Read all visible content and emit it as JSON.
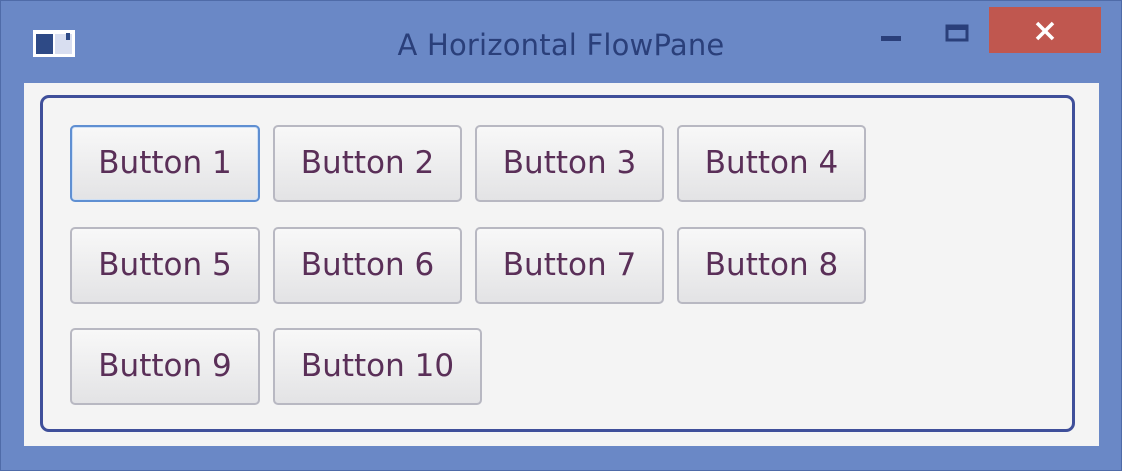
{
  "window": {
    "title": "A Horizontal FlowPane",
    "colors": {
      "frame": "#6a88c6",
      "title_text": "#2a3f7a",
      "close_button": "#c0574f",
      "pane_border": "#3f4f9a",
      "focus_border": "#5f8fd2"
    },
    "controls": {
      "minimize_icon": "minimize-icon",
      "maximize_icon": "maximize-icon",
      "close_icon": "close-icon"
    }
  },
  "flowpane": {
    "orientation": "horizontal",
    "buttons": [
      {
        "label": "Button 1",
        "focused": true
      },
      {
        "label": "Button 2",
        "focused": false
      },
      {
        "label": "Button 3",
        "focused": false
      },
      {
        "label": "Button 4",
        "focused": false
      },
      {
        "label": "Button 5",
        "focused": false
      },
      {
        "label": "Button 6",
        "focused": false
      },
      {
        "label": "Button 7",
        "focused": false
      },
      {
        "label": "Button 8",
        "focused": false
      },
      {
        "label": "Button 9",
        "focused": false
      },
      {
        "label": "Button 10",
        "focused": false
      }
    ]
  }
}
